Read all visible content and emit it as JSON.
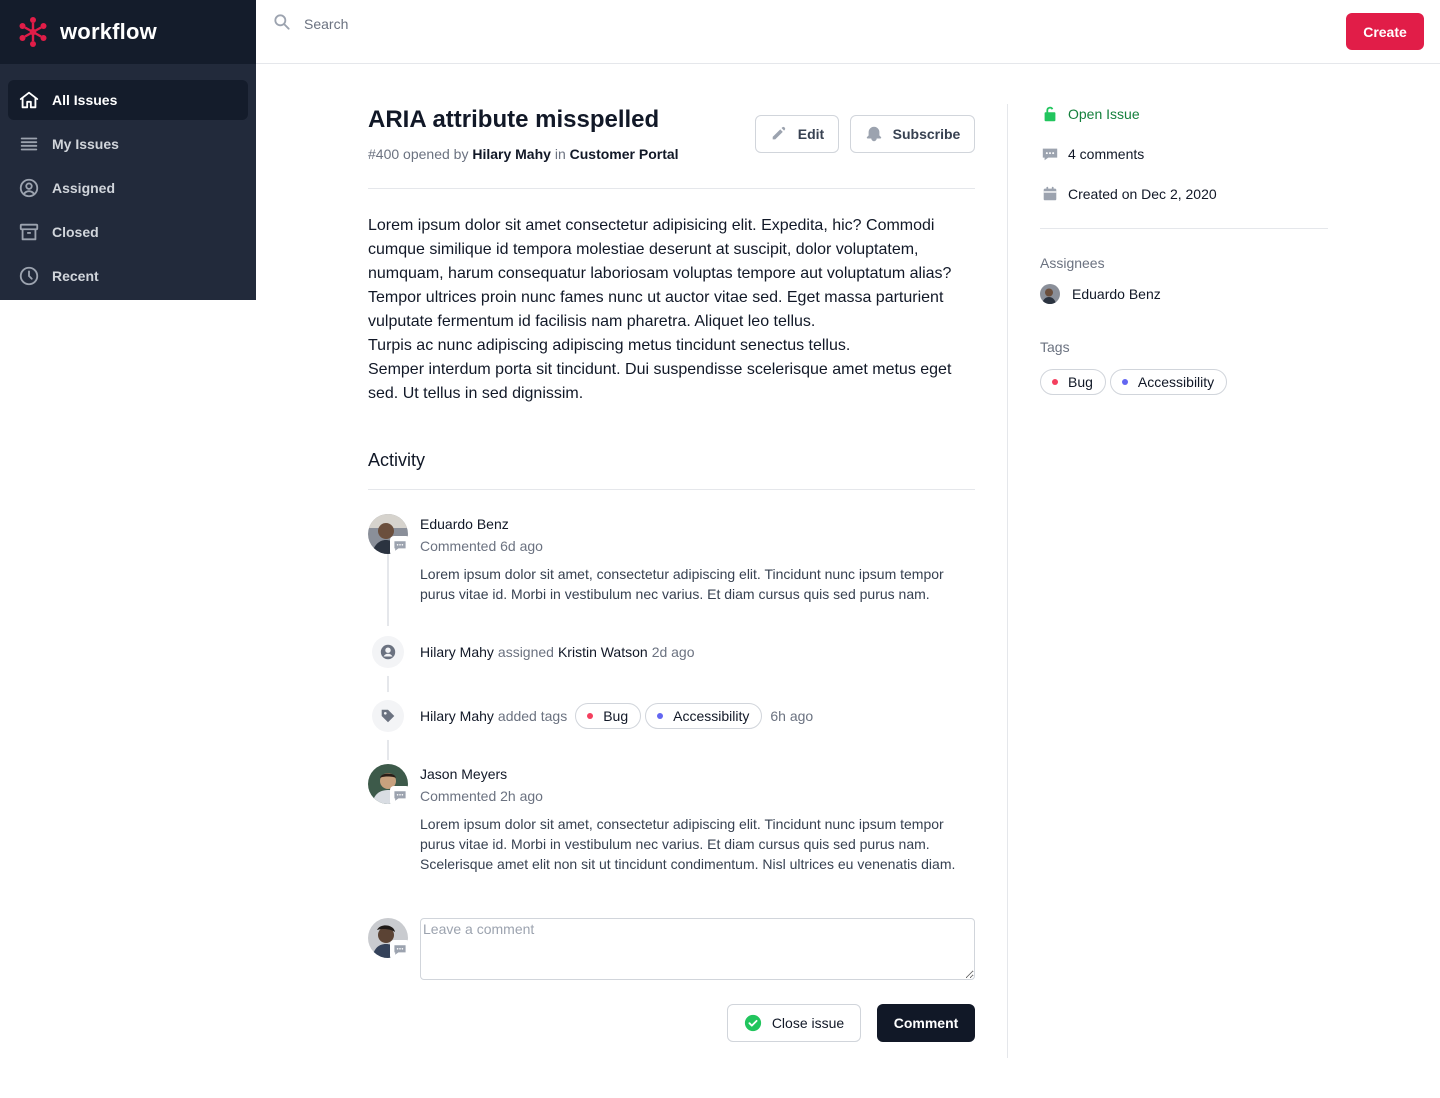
{
  "app": {
    "brand": "workflow"
  },
  "colors": {
    "brand_accent": "#e11d48",
    "sidebar_bg": "#222a3b",
    "sidebar_header_bg": "#141c2b",
    "open_green": "#15803d",
    "bug_dot": "#f43f5e",
    "accessibility_dot": "#6366f1"
  },
  "sidebar": {
    "items": [
      {
        "label": "All Issues",
        "icon": "home-icon",
        "active": true
      },
      {
        "label": "My Issues",
        "icon": "menu-lines-icon",
        "active": false
      },
      {
        "label": "Assigned",
        "icon": "user-circle-icon",
        "active": false
      },
      {
        "label": "Closed",
        "icon": "archive-icon",
        "active": false
      },
      {
        "label": "Recent",
        "icon": "clock-icon",
        "active": false
      }
    ]
  },
  "header": {
    "search_placeholder": "Search",
    "create_label": "Create"
  },
  "issue": {
    "title": "ARIA attribute misspelled",
    "number": "#400",
    "opened_by_text": "opened by",
    "author": "Hilary Mahy",
    "in_text": "in",
    "project": "Customer Portal",
    "edit_label": "Edit",
    "subscribe_label": "Subscribe",
    "description": [
      "Lorem ipsum dolor sit amet consectetur adipisicing elit. Expedita, hic? Commodi cumque similique id tempora molestiae deserunt at suscipit, dolor voluptatem, numquam, harum consequatur laboriosam voluptas tempore aut voluptatum alias?",
      "Tempor ultrices proin nunc fames nunc ut auctor vitae sed. Eget massa parturient vulputate fermentum id facilisis nam pharetra. Aliquet leo tellus.",
      "Turpis ac nunc adipiscing adipiscing metus tincidunt senectus tellus.",
      "Semper interdum porta sit tincidunt. Dui suspendisse scelerisque amet metus eget sed. Ut tellus in sed dignissim."
    ]
  },
  "activity": {
    "title": "Activity",
    "items": [
      {
        "type": "comment",
        "name": "Eduardo Benz",
        "time": "Commented 6d ago",
        "body": "Lorem ipsum dolor sit amet, consectetur adipiscing elit. Tincidunt nunc ipsum tempor purus vitae id. Morbi in vestibulum nec varius. Et diam cursus quis sed purus nam."
      },
      {
        "type": "assignment",
        "actor": "Hilary Mahy",
        "verb": "assigned",
        "target": "Kristin Watson",
        "time": "2d ago"
      },
      {
        "type": "tags",
        "actor": "Hilary Mahy",
        "verb": "added tags",
        "tags": [
          "Bug",
          "Accessibility"
        ],
        "time": "6h ago"
      },
      {
        "type": "comment",
        "name": "Jason Meyers",
        "time": "Commented 2h ago",
        "body": "Lorem ipsum dolor sit amet, consectetur adipiscing elit. Tincidunt nunc ipsum tempor purus vitae id. Morbi in vestibulum nec varius. Et diam cursus quis sed purus nam. Scelerisque amet elit non sit ut tincidunt condimentum. Nisl ultrices eu venenatis diam."
      }
    ],
    "comment_placeholder": "Leave a comment",
    "close_issue_label": "Close issue",
    "comment_label": "Comment"
  },
  "aside": {
    "status": "Open Issue",
    "comments": "4 comments",
    "created": "Created on Dec 2, 2020",
    "assignees_label": "Assignees",
    "assignee": "Eduardo Benz",
    "tags_label": "Tags",
    "tags": [
      "Bug",
      "Accessibility"
    ]
  }
}
